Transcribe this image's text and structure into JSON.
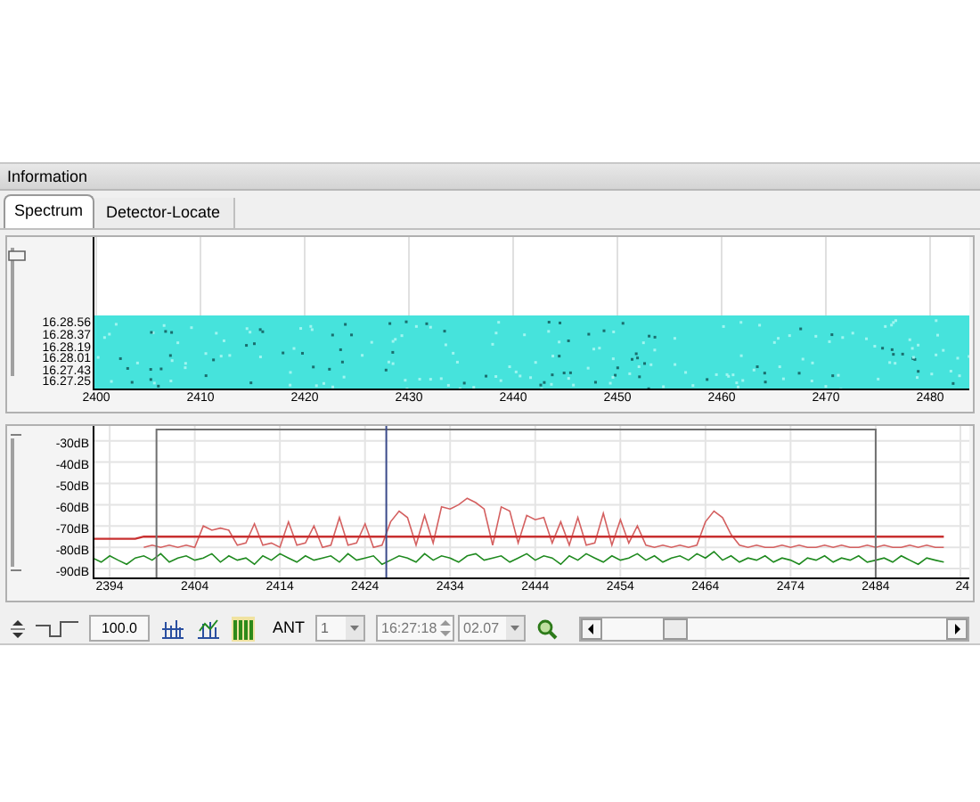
{
  "panel": {
    "title": "Information"
  },
  "tabs": [
    {
      "label": "Spectrum",
      "selected": true
    },
    {
      "label": "Detector-Locate",
      "selected": false
    }
  ],
  "waterfall": {
    "time_labels": [
      "16.28.56",
      "16.28.37",
      "16.28.19",
      "16.28.01",
      "16.27.43",
      "16.27.25"
    ],
    "freq_labels": [
      "2400",
      "2410",
      "2420",
      "2430",
      "2440",
      "2450",
      "2460",
      "2470",
      "2480"
    ]
  },
  "spectrum": {
    "chart_data": {
      "type": "line",
      "x": [
        2392,
        2393,
        2394,
        2395,
        2396,
        2397,
        2398,
        2399,
        2400,
        2401,
        2402,
        2403,
        2404,
        2405,
        2406,
        2407,
        2408,
        2409,
        2410,
        2411,
        2412,
        2413,
        2414,
        2415,
        2416,
        2417,
        2418,
        2419,
        2420,
        2421,
        2422,
        2423,
        2424,
        2425,
        2426,
        2427,
        2428,
        2429,
        2430,
        2431,
        2432,
        2433,
        2434,
        2435,
        2436,
        2437,
        2438,
        2439,
        2440,
        2441,
        2442,
        2443,
        2444,
        2445,
        2446,
        2447,
        2448,
        2449,
        2450,
        2451,
        2452,
        2453,
        2454,
        2455,
        2456,
        2457,
        2458,
        2459,
        2460,
        2461,
        2462,
        2463,
        2464,
        2465,
        2466,
        2467,
        2468,
        2469,
        2470,
        2471,
        2472,
        2473,
        2474,
        2475,
        2476,
        2477,
        2478,
        2479,
        2480,
        2481,
        2482,
        2483,
        2484,
        2485,
        2486,
        2487,
        2488,
        2489,
        2490,
        2491,
        2492
      ],
      "series": [
        {
          "color": "#c83030",
          "values": [
            -76,
            -76,
            -76,
            -76,
            -76,
            -76,
            -75,
            -75,
            -75,
            -75,
            -75,
            -75,
            -75,
            -75,
            -75,
            -75,
            -75,
            -75,
            -75,
            -75,
            -75,
            -75,
            -75,
            -75,
            -75,
            -75,
            -75,
            -75,
            -75,
            -75,
            -75,
            -75,
            -75,
            -75,
            -75,
            -75,
            -75,
            -75,
            -75,
            -75,
            -75,
            -75,
            -75,
            -75,
            -75,
            -75,
            -75,
            -75,
            -75,
            -75,
            -75,
            -75,
            -75,
            -75,
            -75,
            -75,
            -75,
            -75,
            -75,
            -75,
            -75,
            -75,
            -75,
            -75,
            -75,
            -75,
            -75,
            -75,
            -75,
            -75,
            -75,
            -75,
            -75,
            -75,
            -75,
            -75,
            -75,
            -75,
            -75,
            -75,
            -75,
            -75,
            -75,
            -75,
            -75,
            -75,
            -75,
            -75,
            -75,
            -75,
            -75,
            -75,
            -75,
            -75,
            -75,
            -75,
            -75,
            -75,
            -75,
            -75,
            -75
          ]
        },
        {
          "color": "#d46060",
          "values": [
            null,
            null,
            null,
            null,
            null,
            null,
            -80,
            -79,
            -80,
            -79,
            -80,
            -79,
            -80,
            -70,
            -72,
            -71,
            -72,
            -79,
            -78,
            -69,
            -79,
            -78,
            -80,
            -68,
            -79,
            -78,
            -70,
            -80,
            -79,
            -66,
            -79,
            -78,
            -69,
            -80,
            -79,
            -68,
            -63,
            -66,
            -79,
            -65,
            -78,
            -61,
            -62,
            -60,
            -57,
            -59,
            -62,
            -79,
            -61,
            -63,
            -78,
            -65,
            -67,
            -66,
            -78,
            -68,
            -79,
            -66,
            -79,
            -78,
            -64,
            -79,
            -67,
            -78,
            -70,
            -79,
            -80,
            -79,
            -80,
            -79,
            -80,
            -79,
            -68,
            -63,
            -66,
            -74,
            -79,
            -80,
            -79,
            -80,
            -80,
            -79,
            -80,
            -79,
            -80,
            -80,
            -79,
            -80,
            -79,
            -80,
            -80,
            -79,
            -80,
            -79,
            -80,
            -80,
            -79,
            -80,
            -79,
            -80,
            -80
          ]
        },
        {
          "color": "#1f8a1f",
          "values": [
            -85,
            -87,
            -84,
            -86,
            -88,
            -85,
            -84,
            -86,
            -83,
            -87,
            -85,
            -84,
            -86,
            -85,
            -83,
            -87,
            -84,
            -86,
            -85,
            -88,
            -84,
            -86,
            -83,
            -85,
            -87,
            -84,
            -86,
            -85,
            -84,
            -87,
            -83,
            -86,
            -85,
            -84,
            -88,
            -86,
            -84,
            -85,
            -87,
            -83,
            -86,
            -84,
            -85,
            -87,
            -84,
            -83,
            -86,
            -85,
            -84,
            -87,
            -85,
            -83,
            -86,
            -84,
            -85,
            -88,
            -84,
            -86,
            -83,
            -85,
            -87,
            -84,
            -86,
            -85,
            -83,
            -86,
            -84,
            -87,
            -85,
            -84,
            -86,
            -83,
            -85,
            -82,
            -86,
            -84,
            -87,
            -85,
            -86,
            -84,
            -87,
            -85,
            -86,
            -88,
            -85,
            -86,
            -84,
            -87,
            -85,
            -86,
            -84,
            -87,
            -86,
            -85,
            -87,
            -84,
            -86,
            -88,
            -85,
            -86,
            -87
          ]
        }
      ],
      "xlim": [
        2392,
        2495
      ],
      "ylim": [
        -95,
        -23
      ],
      "xticks": [
        {
          "value": 2394,
          "label": "2394"
        },
        {
          "value": 2404,
          "label": "2404"
        },
        {
          "value": 2414,
          "label": "2414"
        },
        {
          "value": 2424,
          "label": "2424"
        },
        {
          "value": 2434,
          "label": "2434"
        },
        {
          "value": 2444,
          "label": "2444"
        },
        {
          "value": 2454,
          "label": "2454"
        },
        {
          "value": 2464,
          "label": "2464"
        },
        {
          "value": 2474,
          "label": "2474"
        },
        {
          "value": 2484,
          "label": "2484"
        }
      ],
      "grid": true,
      "ref_lines": [
        {
          "axis": "x",
          "value": 2426.5,
          "color": "#3a4a8a"
        }
      ],
      "yticks": [
        {
          "value": -30,
          "label": "-30dB"
        },
        {
          "value": -40,
          "label": "-40dB"
        },
        {
          "value": -50,
          "label": "-50dB"
        },
        {
          "value": -60,
          "label": "-60dB"
        },
        {
          "value": -70,
          "label": "-70dB"
        },
        {
          "value": -80,
          "label": "-80dB"
        },
        {
          "value": -90,
          "label": "-90dB"
        }
      ]
    },
    "edge_label": "24"
  },
  "toolbar": {
    "zoom_value": "100.0",
    "ant_label": "ANT",
    "ant_value": "1",
    "time_value": "16:27:18",
    "date_value": "02.07"
  }
}
